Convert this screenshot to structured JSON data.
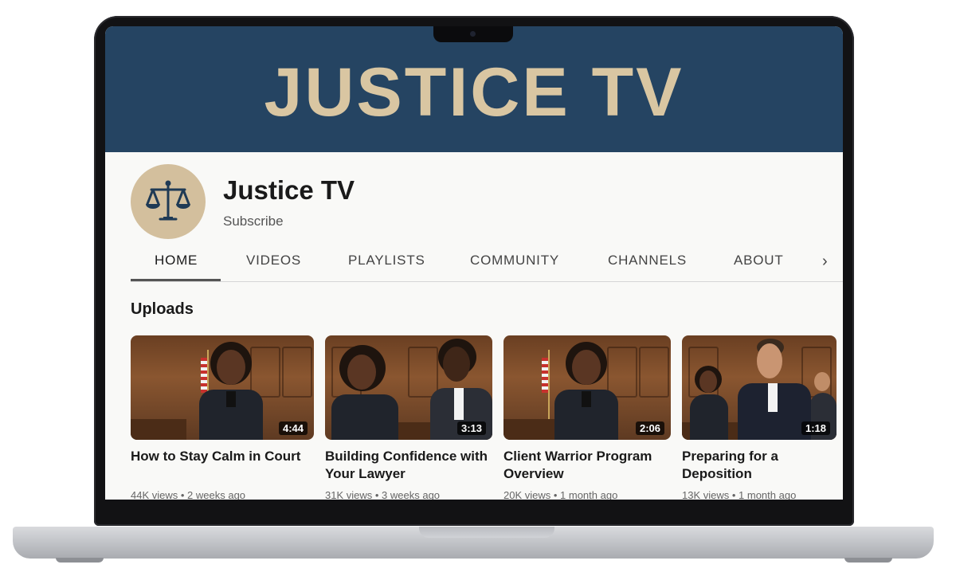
{
  "banner": {
    "text": "JUSTICE TV",
    "bg": "#254462",
    "fg": "#d9c6a2"
  },
  "channel": {
    "name": "Justice TV",
    "subscribe_label": "Subscribe",
    "avatar_icon": "scales-of-justice-icon",
    "avatar_bg": "#d3bf9d"
  },
  "tabs": [
    {
      "label": "HOME",
      "active": true
    },
    {
      "label": "VIDEOS"
    },
    {
      "label": "PLAYLISTS"
    },
    {
      "label": "COMMUNITY"
    },
    {
      "label": "CHANNELS"
    },
    {
      "label": "ABOUT"
    }
  ],
  "tabs_next_icon": "chevron-right-icon",
  "uploads": {
    "title": "Uploads",
    "videos": [
      {
        "title": "How to Stay Calm in Court",
        "duration": "4:44",
        "views": "44K views",
        "age": "2 weeks ago"
      },
      {
        "title": "Building Confidence with Your Lawyer",
        "duration": "3:13",
        "views": "31K views",
        "age": "3 weeks ago"
      },
      {
        "title": "Client Warrior Program Overview",
        "duration": "2:06",
        "views": "20K views",
        "age": "1 month ago"
      },
      {
        "title": "Preparing for a Deposition",
        "duration": "1:18",
        "views": "13K views",
        "age": "1 month ago"
      }
    ]
  }
}
